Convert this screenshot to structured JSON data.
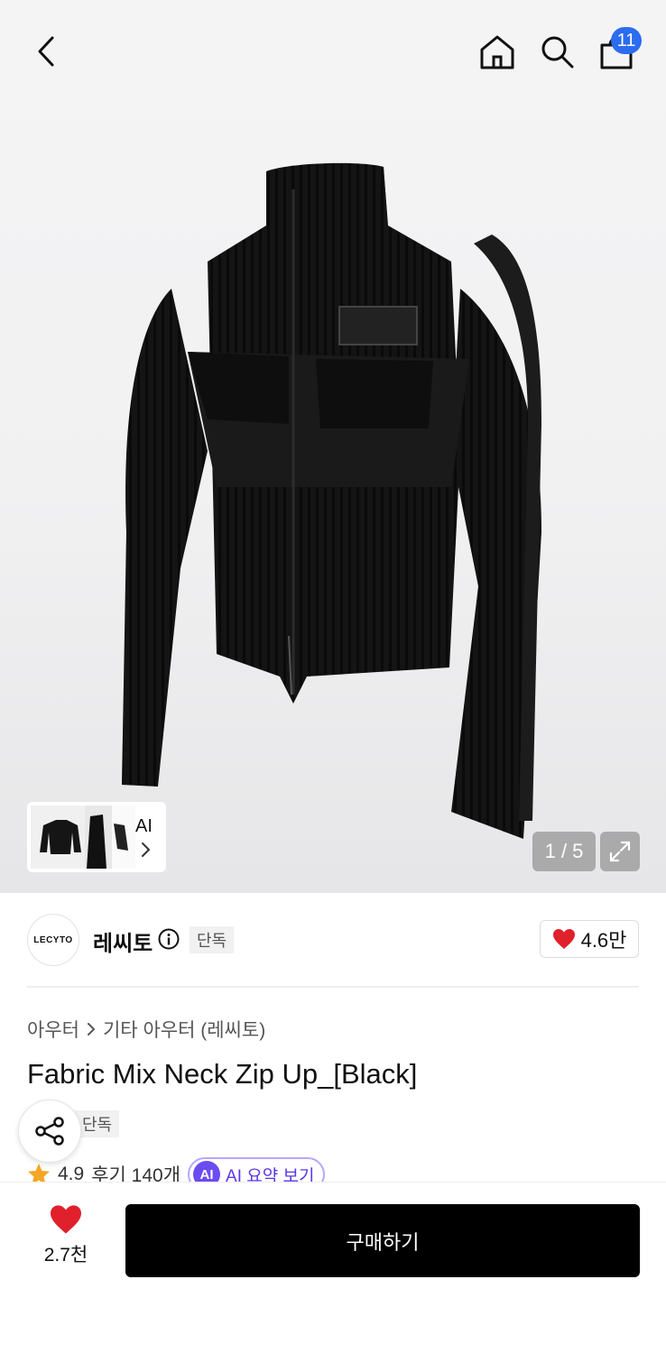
{
  "header": {
    "back_icon": "chevron-left-icon",
    "home_icon": "home-icon",
    "search_icon": "search-icon",
    "cart_icon": "shopping-bag-icon",
    "cart_count": "11"
  },
  "gallery": {
    "counter": "1 / 5",
    "thumb_label": "AI",
    "expand_icon": "expand-icon"
  },
  "brand": {
    "logo_text": "LECYTO",
    "name": "레씨토",
    "exclusive_tag": "단독",
    "likes": "4.6만"
  },
  "product": {
    "breadcrumb": [
      "아우터",
      "기타 아우터 (레씨토)"
    ],
    "title": "Fabric Mix Neck Zip Up_[Black]",
    "exclusive_tag": "단독",
    "rating": "4.9",
    "reviews": "후기 140개",
    "ai_badge": "AI",
    "ai_summary_label": "AI 요약 보기"
  },
  "bottom_bar": {
    "wish_count": "2.7천",
    "buy_label": "구매하기"
  },
  "colors": {
    "accent_blue": "#2b6cf0",
    "heart_red": "#e0202a",
    "ai_purple": "#6b4cf0",
    "buy_black": "#000000"
  }
}
